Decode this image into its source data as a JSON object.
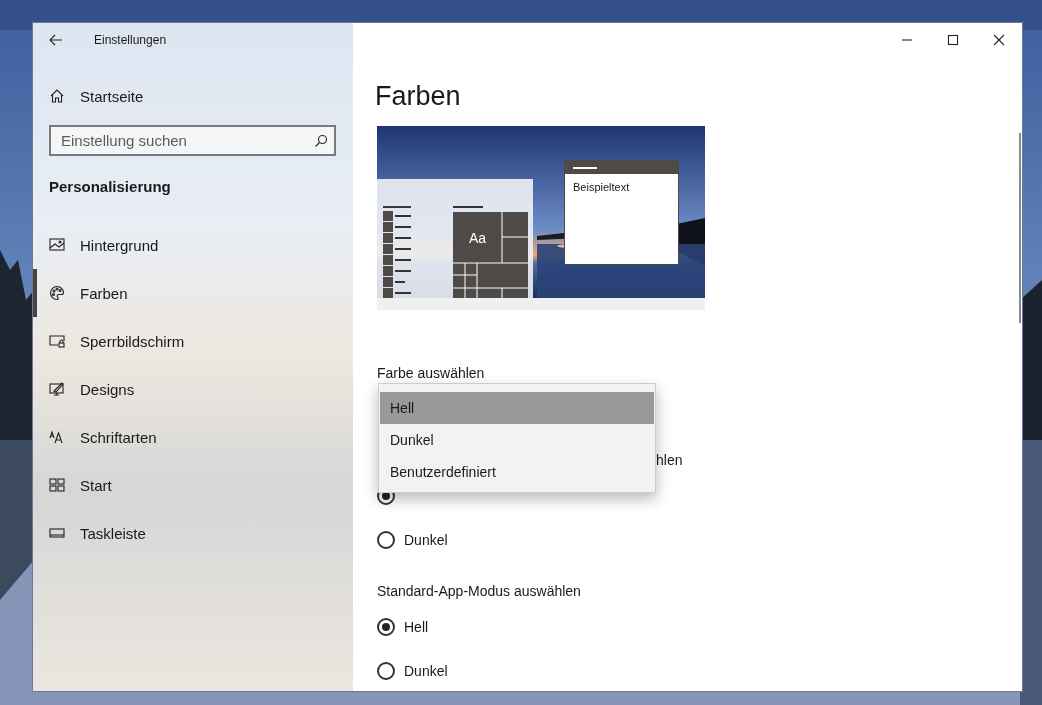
{
  "window": {
    "title": "Einstellungen"
  },
  "sidebar": {
    "home": "Startseite",
    "search": {
      "placeholder": "Einstellung suchen"
    },
    "section": "Personalisierung",
    "items": [
      {
        "label": "Hintergrund",
        "selected": false
      },
      {
        "label": "Farben",
        "selected": true
      },
      {
        "label": "Sperrbildschirm",
        "selected": false
      },
      {
        "label": "Designs",
        "selected": false
      },
      {
        "label": "Schriftarten",
        "selected": false
      },
      {
        "label": "Start",
        "selected": false
      },
      {
        "label": "Taskleiste",
        "selected": false
      }
    ]
  },
  "content": {
    "title": "Farben",
    "preview": {
      "tile_text": "Aa",
      "sample_text": "Beispieltext"
    },
    "color_label": "Farbe auswählen",
    "dropdown": {
      "expanded": true,
      "options": [
        {
          "label": "Hell",
          "selected": true
        },
        {
          "label": "Dunkel",
          "selected": false
        },
        {
          "label": "Benutzerdefiniert",
          "selected": false
        }
      ]
    },
    "sections": [
      {
        "heading": "hlen",
        "options": [
          {
            "selected": true
          },
          {
            "label": "Dunkel",
            "selected": false
          }
        ]
      },
      {
        "heading": "Standard-App-Modus auswählen",
        "options": [
          {
            "label": "Hell",
            "selected": true
          },
          {
            "label": "Dunkel",
            "selected": false
          }
        ]
      }
    ]
  }
}
